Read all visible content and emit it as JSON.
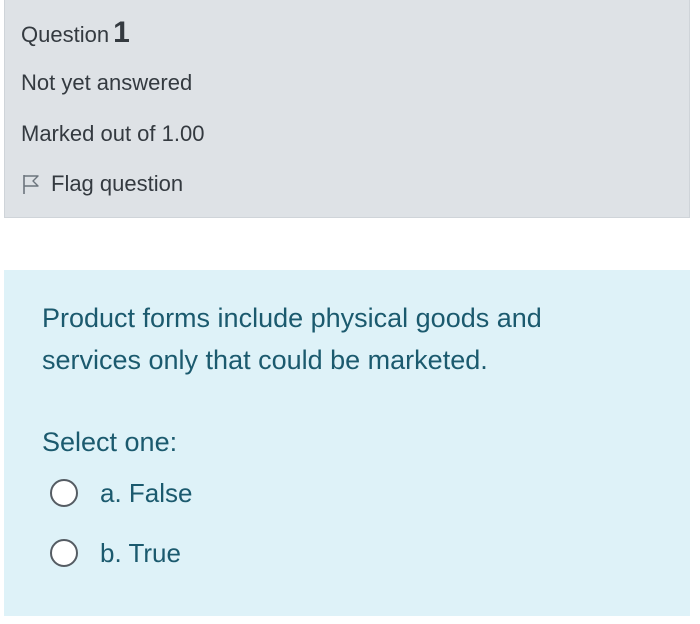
{
  "info": {
    "question_label": "Question",
    "question_number": "1",
    "state": "Not yet answered",
    "grade": "Marked out of 1.00",
    "flag_label": "Flag question",
    "flag_icon": "flag-outline-icon"
  },
  "content": {
    "question_text": "Product forms include physical goods and services only that could be marketed.",
    "prompt": "Select one:",
    "options": [
      {
        "label": "a. False",
        "selected": false
      },
      {
        "label": "b. True",
        "selected": false
      }
    ]
  },
  "colors": {
    "info_background": "#dee2e6",
    "content_background": "#def2f8",
    "info_text": "#343a40",
    "content_text": "#1b5a6e"
  }
}
